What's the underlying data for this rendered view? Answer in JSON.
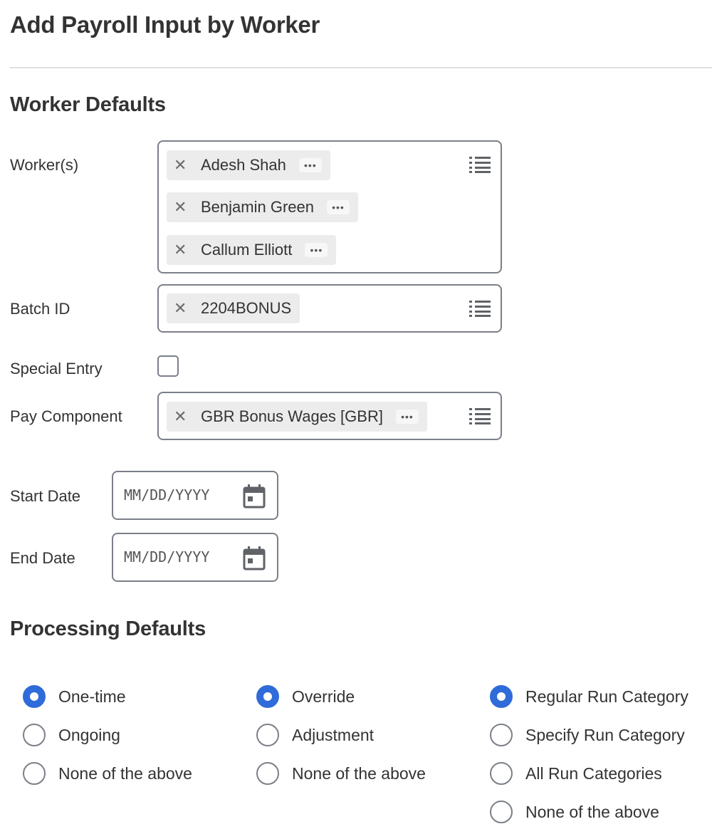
{
  "page": {
    "title": "Add Payroll Input by Worker"
  },
  "sections": {
    "worker_defaults": "Worker Defaults",
    "processing_defaults": "Processing Defaults"
  },
  "fields": {
    "workers": {
      "label": "Worker(s)",
      "values": [
        "Adesh Shah",
        "Benjamin Green",
        "Callum Elliott"
      ]
    },
    "batch_id": {
      "label": "Batch ID",
      "value": "2204BONUS"
    },
    "special_entry": {
      "label": "Special Entry",
      "checked": false
    },
    "pay_component": {
      "label": "Pay Component",
      "value": "GBR Bonus Wages [GBR]"
    },
    "start_date": {
      "label": "Start Date",
      "placeholder": "MM/DD/YYYY"
    },
    "end_date": {
      "label": "End Date",
      "placeholder": "MM/DD/YYYY"
    }
  },
  "processing": {
    "frequency": {
      "options": [
        "One-time",
        "Ongoing",
        "None of the above"
      ],
      "selected": "One-time"
    },
    "input_type": {
      "options": [
        "Override",
        "Adjustment",
        "None of the above"
      ],
      "selected": "Override"
    },
    "run_category": {
      "options": [
        "Regular Run Category",
        "Specify Run Category",
        "All Run Categories",
        "None of the above"
      ],
      "selected": "Regular Run Category"
    }
  },
  "icons": {
    "remove": "close-icon",
    "more": "more-icon",
    "prompt": "list-icon",
    "calendar": "calendar-icon"
  },
  "colors": {
    "accent": "#2f6bd9",
    "border": "#7b7f88",
    "pill_bg": "#ececec"
  }
}
